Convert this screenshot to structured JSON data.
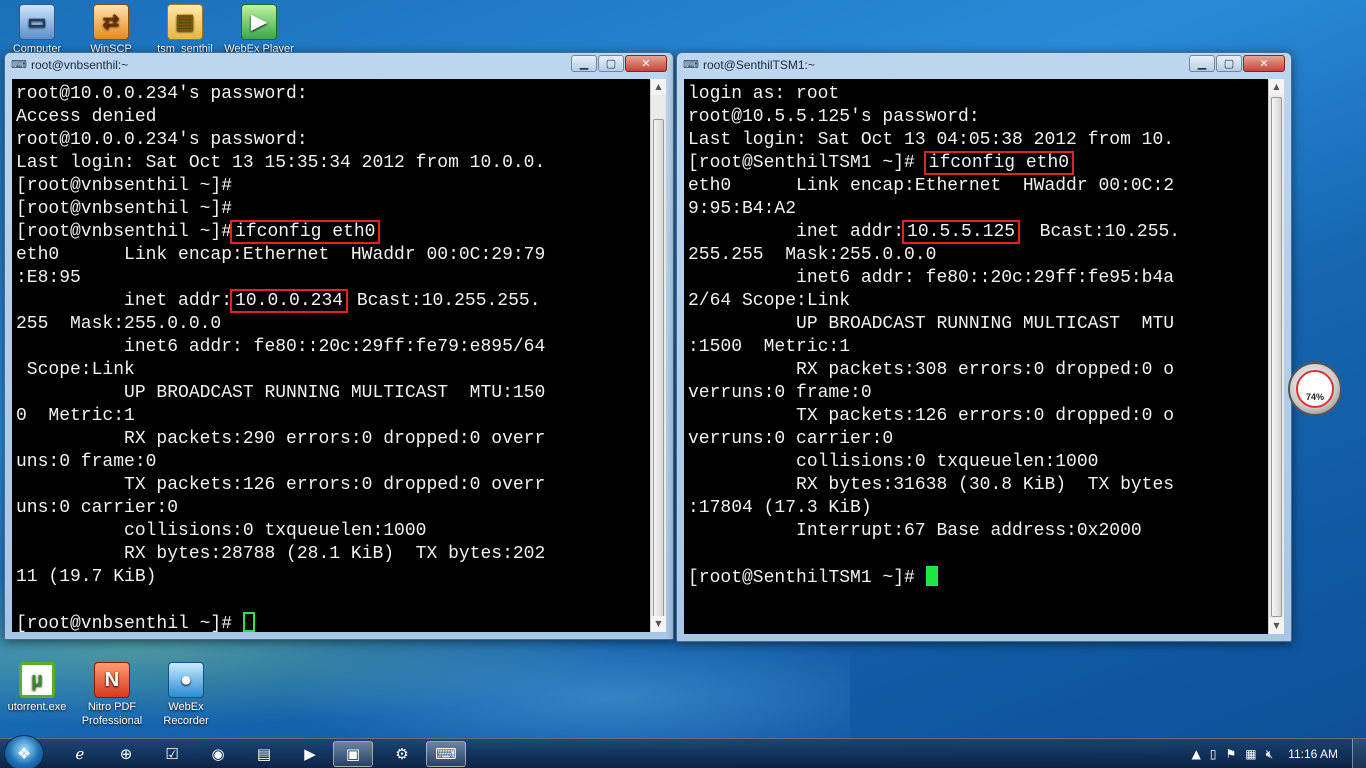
{
  "desktop": {
    "top_icons": [
      {
        "label": "Computer",
        "icon": "computer-icon"
      },
      {
        "label": "WinSCP",
        "icon": "winscp-icon"
      },
      {
        "label": "tsm_senthil",
        "icon": "folder-icon"
      },
      {
        "label": "WebEx Player",
        "icon": "webex-player-icon"
      }
    ],
    "bottom_icons": [
      {
        "label": "utorrent.exe",
        "icon": "utorrent-icon"
      },
      {
        "label": "Nitro PDF Professional",
        "icon": "nitro-pdf-icon"
      },
      {
        "label": "WebEx Recorder",
        "icon": "webex-recorder-icon"
      }
    ]
  },
  "window_left": {
    "title": "root@vnbsenthil:~",
    "lines": [
      "root@10.0.0.234's password:",
      "Access denied",
      "root@10.0.0.234's password:",
      "Last login: Sat Oct 13 15:35:34 2012 from 10.0.0.",
      "[root@vnbsenthil ~]#",
      "[root@vnbsenthil ~]#",
      "[root@vnbsenthil ~]#",
      "eth0      Link encap:Ethernet  HWaddr 00:0C:29:79",
      ":E8:95",
      "          inet addr:",
      "255  Mask:255.0.0.0",
      "          inet6 addr: fe80::20c:29ff:fe79:e895/64",
      " Scope:Link",
      "          UP BROADCAST RUNNING MULTICAST  MTU:150",
      "0  Metric:1",
      "          RX packets:290 errors:0 dropped:0 overr",
      "uns:0 frame:0",
      "          TX packets:126 errors:0 dropped:0 overr",
      "uns:0 carrier:0",
      "          collisions:0 txqueuelen:1000",
      "          RX bytes:28788 (28.1 KiB)  TX bytes:202",
      "11 (19.7 KiB)",
      "",
      "[root@vnbsenthil ~]# "
    ],
    "cmd_prompt": "[root@vnbsenthil ~]# ",
    "cmd_highlight": "ifconfig eth0",
    "ip_highlight": "10.0.0.234",
    "ip_suffix": " Bcast:10.255.255."
  },
  "window_right": {
    "title": "root@SenthilTSM1:~",
    "lines": [
      "login as: root",
      "root@10.5.5.125's password:",
      "Last login: Sat Oct 13 04:05:38 2012 from 10.",
      "[root@SenthilTSM1 ~]# ",
      "eth0      Link encap:Ethernet  HWaddr 00:0C:2",
      "9:95:B4:A2",
      "          inet addr:",
      "255.255  Mask:255.0.0.0",
      "          inet6 addr: fe80::20c:29ff:fe95:b4a",
      "2/64 Scope:Link",
      "          UP BROADCAST RUNNING MULTICAST  MTU",
      ":1500  Metric:1",
      "          RX packets:308 errors:0 dropped:0 o",
      "verruns:0 frame:0",
      "          TX packets:126 errors:0 dropped:0 o",
      "verruns:0 carrier:0",
      "          collisions:0 txqueuelen:1000",
      "          RX bytes:31638 (30.8 KiB)  TX bytes",
      ":17804 (17.3 KiB)",
      "          Interrupt:67 Base address:0x2000",
      "",
      "[root@SenthilTSM1 ~]# "
    ],
    "cmd_highlight": "ifconfig eth0",
    "ip_highlight": "10.5.5.125",
    "ip_suffix": "  Bcast:10.255."
  },
  "gadget": {
    "label": "74%"
  },
  "taskbar": {
    "items": [
      {
        "icon": "internet-explorer-icon"
      },
      {
        "icon": "hp-icon"
      },
      {
        "icon": "checkbox-app-icon"
      },
      {
        "icon": "media-icon"
      },
      {
        "icon": "folder-explorer-icon"
      },
      {
        "icon": "media-player-icon"
      },
      {
        "icon": "window-app-icon"
      },
      {
        "icon": "network-app-icon"
      },
      {
        "icon": "putty-icon"
      }
    ],
    "clock": "11:16 AM"
  },
  "colors": {
    "highlight_box": "#e0251e",
    "cursor_green": "#1ee83f",
    "terminal_bg": "#000000"
  }
}
